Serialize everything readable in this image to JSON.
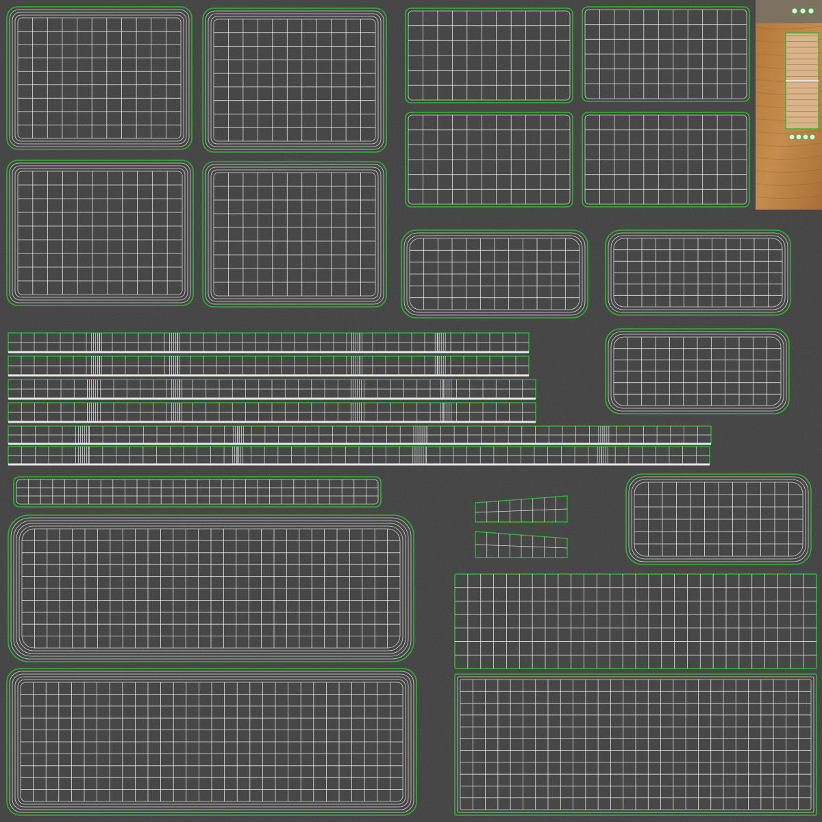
{
  "texture": {
    "background_color": "#3c3c3c",
    "noise_color": "#5a5a5a",
    "wire_color": "#e6e6e6",
    "seam_color": "#2db82d",
    "wood_color": "#b27a3c",
    "wood_light": "#c99458",
    "strap_color": "#e8e8e8"
  },
  "islands": {
    "cushion_tiles_count": 4,
    "panel_tiles_count": 4,
    "pillow_tiles_count": 4,
    "strip_rows_count": 7,
    "wedge_count": 2,
    "large_panels_count": 4,
    "wood_piece_count": 1
  }
}
